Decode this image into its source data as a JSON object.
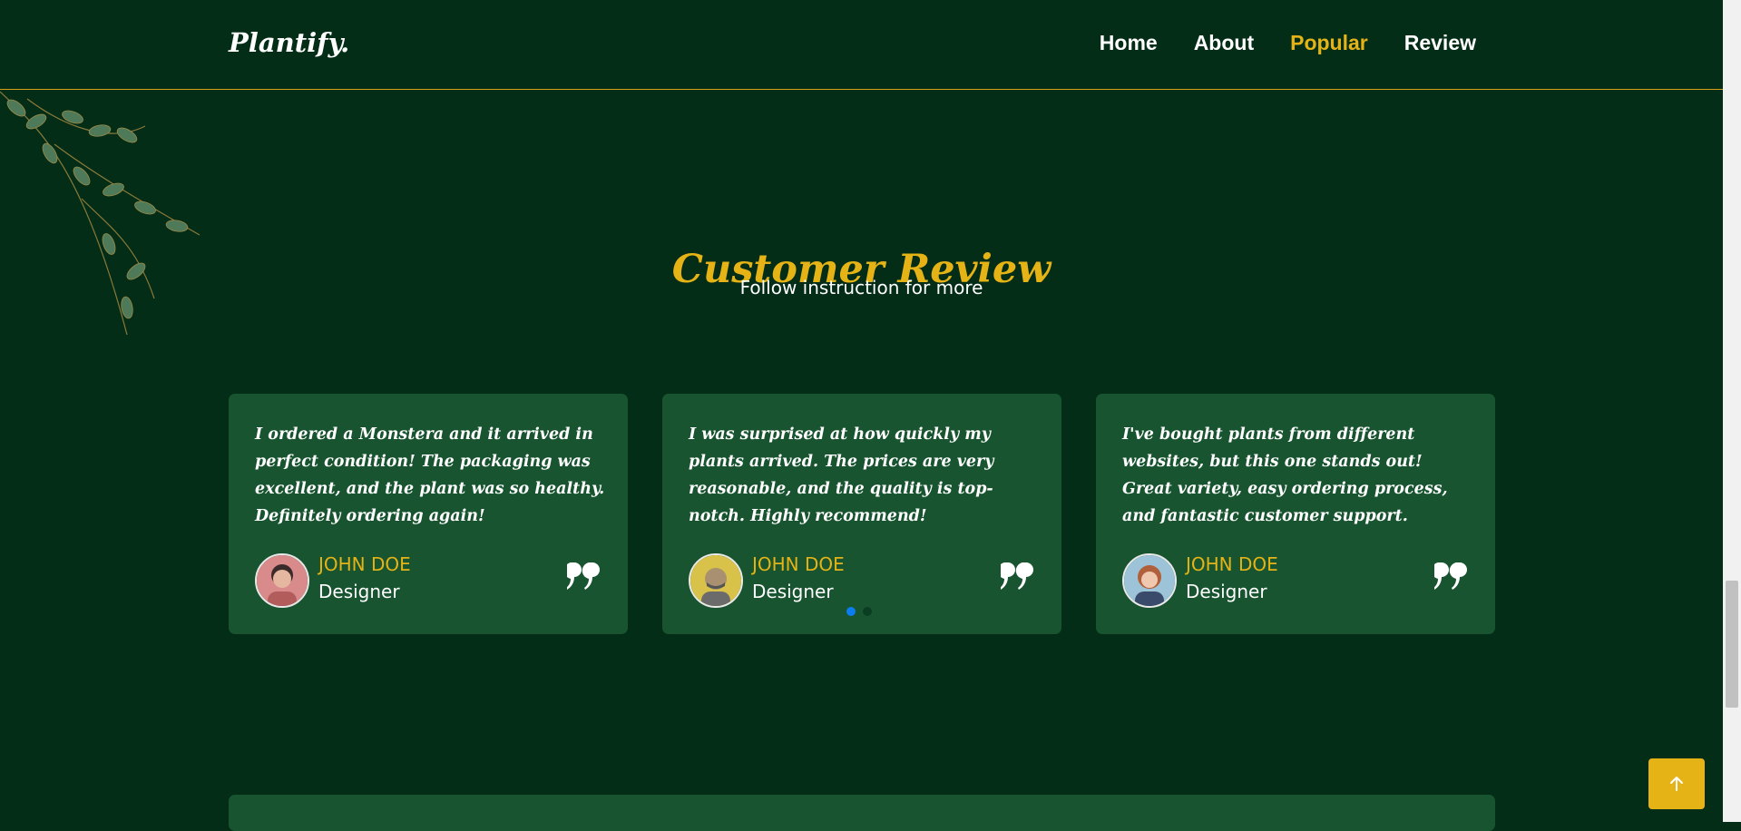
{
  "header": {
    "logo": "Plantify.",
    "nav": [
      {
        "label": "Home",
        "active": false
      },
      {
        "label": "About",
        "active": false
      },
      {
        "label": "Popular",
        "active": true
      },
      {
        "label": "Review",
        "active": false
      }
    ]
  },
  "section": {
    "title": "Customer Review",
    "subtitle": "Follow instruction for more"
  },
  "reviews": [
    {
      "text": "I ordered a Monstera and it arrived in perfect condition! The packaging was excellent, and the plant was so healthy. Definitely ordering again!",
      "name": "JOHN DOE",
      "role": "Designer"
    },
    {
      "text": "I was surprised at how quickly my plants arrived. The prices are very reasonable, and the quality is top-notch. Highly recommend!",
      "name": "JOHN DOE",
      "role": "Designer"
    },
    {
      "text": "I've bought plants from different websites, but this one stands out! Great variety, easy ordering process, and fantastic customer support.",
      "name": "JOHN DOE",
      "role": "Designer"
    }
  ],
  "carousel": {
    "active_index": 0,
    "count": 2
  },
  "colors": {
    "background": "#032d17",
    "card": "#17542f",
    "accent": "#e5b316",
    "dot_active": "#0b7df0"
  },
  "icons": {
    "quote": "quote-icon",
    "back_to_top": "arrow-up-icon"
  }
}
